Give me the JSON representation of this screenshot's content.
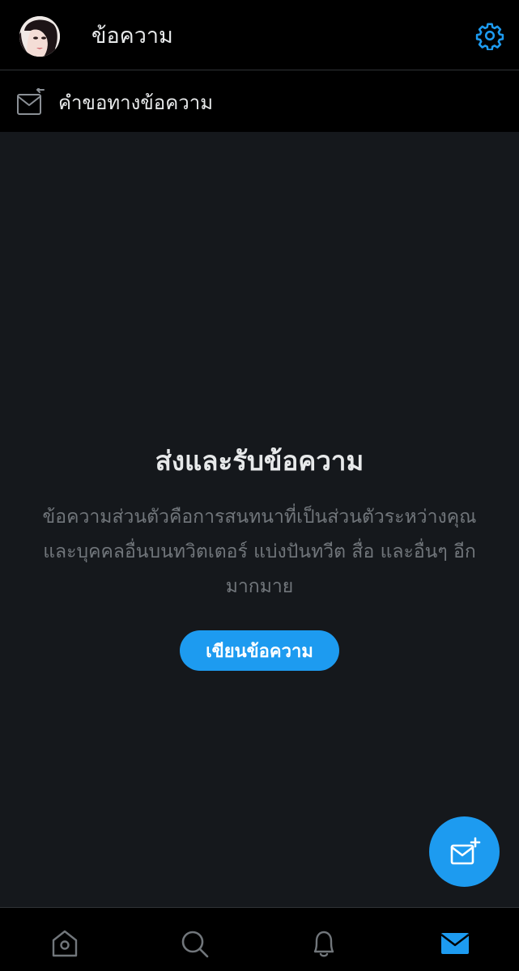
{
  "header": {
    "title": "ข้อความ",
    "avatar_icon": "avatar",
    "settings_icon": "gear-icon"
  },
  "requests": {
    "label": "คำขอทางข้อความ",
    "icon": "message-request-icon"
  },
  "empty_state": {
    "title": "ส่งและรับข้อความ",
    "description": "ข้อความส่วนตัวคือการสนทนาที่เป็นส่วนตัวระหว่างคุณและบุคคลอื่นบนทวิตเตอร์ แบ่งปันทวีต สื่อ และอื่นๆ อีกมากมาย",
    "button_label": "เขียนข้อความ"
  },
  "fab": {
    "icon": "new-message-icon"
  },
  "bottom_nav": {
    "items": [
      {
        "icon": "home-icon",
        "active": false
      },
      {
        "icon": "search-icon",
        "active": false
      },
      {
        "icon": "bell-icon",
        "active": false
      },
      {
        "icon": "mail-icon",
        "active": true
      }
    ]
  },
  "colors": {
    "accent": "#1d9bf0",
    "background": "#15181c",
    "bar": "#000000",
    "text_primary": "#e7e9ea",
    "text_secondary": "#71767b"
  }
}
